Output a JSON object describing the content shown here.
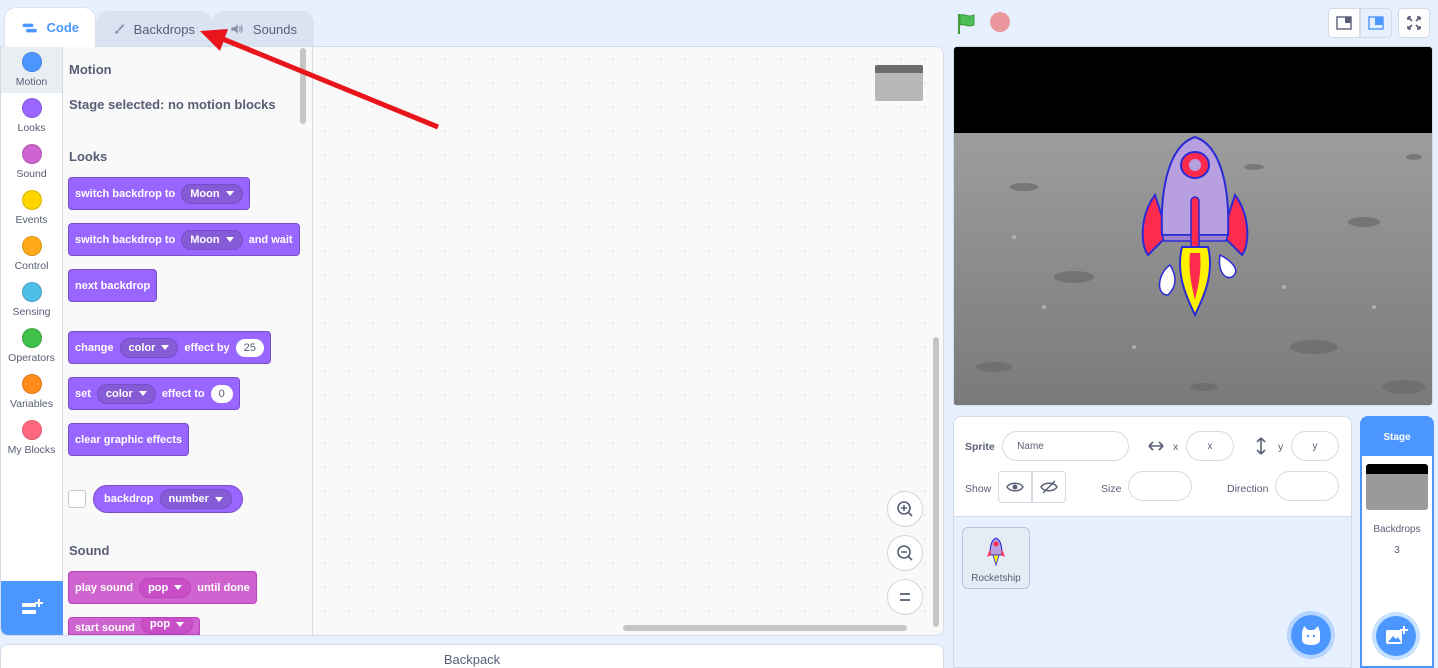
{
  "tabs": [
    {
      "label": "Code",
      "active": true
    },
    {
      "label": "Backdrops",
      "active": false
    },
    {
      "label": "Sounds",
      "active": false
    }
  ],
  "categories": [
    {
      "label": "Motion",
      "color": "#4c97ff"
    },
    {
      "label": "Looks",
      "color": "#9966ff"
    },
    {
      "label": "Sound",
      "color": "#cf63cf"
    },
    {
      "label": "Events",
      "color": "#ffd500"
    },
    {
      "label": "Control",
      "color": "#ffab19"
    },
    {
      "label": "Sensing",
      "color": "#4cbfe6"
    },
    {
      "label": "Operators",
      "color": "#40bf4a"
    },
    {
      "label": "Variables",
      "color": "#ff8c1a"
    },
    {
      "label": "My Blocks",
      "color": "#ff6680"
    }
  ],
  "palette": {
    "motion_title": "Motion",
    "motion_note": "Stage selected: no motion blocks",
    "looks_title": "Looks",
    "sound_title": "Sound",
    "b1": {
      "text": "switch backdrop to",
      "dd": "Moon"
    },
    "b2": {
      "text": "switch backdrop to",
      "dd": "Moon",
      "tail": "and wait"
    },
    "b3": {
      "text": "next backdrop"
    },
    "b4": {
      "text": "change",
      "dd": "color",
      "mid": "effect by",
      "num": "25"
    },
    "b5": {
      "text": "set",
      "dd": "color",
      "mid": "effect to",
      "num": "0"
    },
    "b6": {
      "text": "clear graphic effects"
    },
    "r1": {
      "text": "backdrop",
      "dd": "number"
    },
    "s1": {
      "text": "play sound",
      "dd": "pop",
      "tail": "until done"
    },
    "s2": {
      "text": "start sound",
      "dd": "pop"
    }
  },
  "backpack": "Backpack",
  "sprite_info": {
    "sprite_label": "Sprite",
    "name_placeholder": "Name",
    "x_label": "x",
    "x_placeholder": "x",
    "y_label": "y",
    "y_placeholder": "y",
    "show_label": "Show",
    "size_label": "Size",
    "direction_label": "Direction"
  },
  "sprites": [
    {
      "name": "Rocketship"
    }
  ],
  "stage_selector": {
    "title": "Stage",
    "backdrops_label": "Backdrops",
    "backdrops_count": "3"
  },
  "colors": {
    "accent": "#4c97ff",
    "looks": "#9966ff",
    "sound": "#cf63cf",
    "annotation_arrow": "#e8151b"
  }
}
